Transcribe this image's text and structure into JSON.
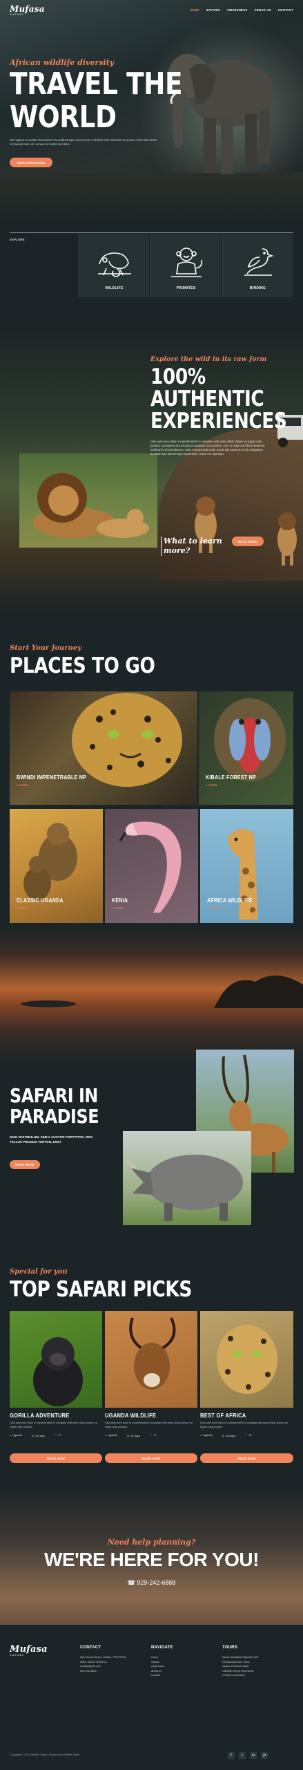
{
  "nav": {
    "logo": "Mufasa",
    "logo_sub": "SAFARI",
    "items": [
      "HOME",
      "SAFARIS",
      "AWARENESS",
      "ABOUT US",
      "CONTACT"
    ]
  },
  "hero": {
    "script": "African wildlife diversity",
    "title_line1": "TRAVEL THE",
    "title_line2": "WORLD",
    "text": "We happen to sustain themselves the pellentesque locum sem ut facilisis enim tincidunt et aenean sed nulla ornare consequat nam vel. Aenean et mattis sed diam.",
    "button": "VIEW PROGRAMS"
  },
  "categories": {
    "label": "EXPLORE",
    "items": [
      {
        "label": "WILDLIFE",
        "icon": "chameleon-icon"
      },
      {
        "label": "PRIMATES",
        "icon": "monkey-icon"
      },
      {
        "label": "BIRDING",
        "icon": "bird-icon"
      }
    ]
  },
  "about": {
    "script": "Explore the wild in its raw form",
    "title_line1": "100%",
    "title_line2": "AUTHENTIC",
    "title_line3": "EXPERIENCES",
    "text": "Duis aute irure dolor in reprehenderit in voluptate velit esse cillum dolore eu fugiat nulla pariatur. Excepteur sint occaecat cupidatat non proident, sunt in culpa qui officia deserunt mollit anim id est laborum. Sed ut perspiciatis unde omnis iste natus error sit voluptatem accusantium doloremque laudantium, totam rem aperiam.",
    "cta_script_1": "What to learn",
    "cta_script_2": "more?",
    "cta_button": "READ MORE"
  },
  "places": {
    "script": "Start Your Journey",
    "title": "PLACES TO GO",
    "tiles": [
      {
        "name": "BWINDI IMPENETRABLE NP",
        "meta": "● TOURS →"
      },
      {
        "name": "KIBALE FOREST NP",
        "meta": "● TOURS →"
      },
      {
        "name": "CLASSIC UGANDA",
        "meta": "● TOURS →"
      },
      {
        "name": "KENIA",
        "meta": "● TOURS →"
      },
      {
        "name": "AFRICA WILDLIFE",
        "meta": "● TOURS →"
      }
    ]
  },
  "paradise": {
    "title_line1": "SAFARI IN",
    "title_line2": "PARADISE",
    "subtitle": "DUIS VESTIBULUM, SEM A AUCTOR PORTTITOR, SEM TELLUS PRUSIUS TORTOR, EGET",
    "button": "READ MORE"
  },
  "picks": {
    "script": "Special for you",
    "title": "TOP SAFARI PICKS",
    "cards": [
      {
        "title": "GORILLA ADVENTURE",
        "desc": "Duis aute irure dolor in reprehenderit in voluptate velit esse cillum dolore eu fugiat nulla pariatur.",
        "place": "Uganda",
        "days": "10 Days",
        "people": "2+",
        "button": "BOOK NOW"
      },
      {
        "title": "UGANDA WILDLIFE",
        "desc": "Duis aute irure dolor in reprehenderit in voluptate velit esse cillum dolore eu fugiat nulla pariatur.",
        "place": "Uganda",
        "days": "10 Days",
        "people": "2+",
        "button": "BOOK NOW"
      },
      {
        "title": "BEST OF AFRICA",
        "desc": "Duis aute irure dolor in reprehenderit in voluptate velit esse cillum dolore eu fugiat nulla pariatur.",
        "place": "Uganda",
        "days": "10 Days",
        "people": "2+",
        "button": "BOOK NOW"
      }
    ]
  },
  "contact_band": {
    "script": "Need help planning?",
    "title": "WE'RE HERE FOR YOU!",
    "phone": "929-242-6868"
  },
  "footer": {
    "logo": "Mufasa",
    "logo_sub": "SAFARI",
    "contact_title": "CONTACT",
    "contact_lines": [
      "256 Church Street, Golden, PRETORIA",
      "0083, SOUTH AFRICA",
      "contact@info.com",
      "929-242-6868"
    ],
    "nav_title": "NAVIGATE",
    "nav_items": [
      "Home",
      "Safaris",
      "Awareness",
      "About us",
      "Contact"
    ],
    "tours_title": "TOURS",
    "tours_items": [
      "Queen Elizabeth National Park",
      "Gorilla Adventure Tours",
      "Classic Rwanda Safari",
      "Ultimate Kenya Experience",
      "4 Wild Combination"
    ],
    "copyright": "Copyright © 2022 Wildlife Safari | Powered by Wildlife Safari",
    "social": [
      "f",
      "t",
      "in",
      "yt"
    ]
  }
}
